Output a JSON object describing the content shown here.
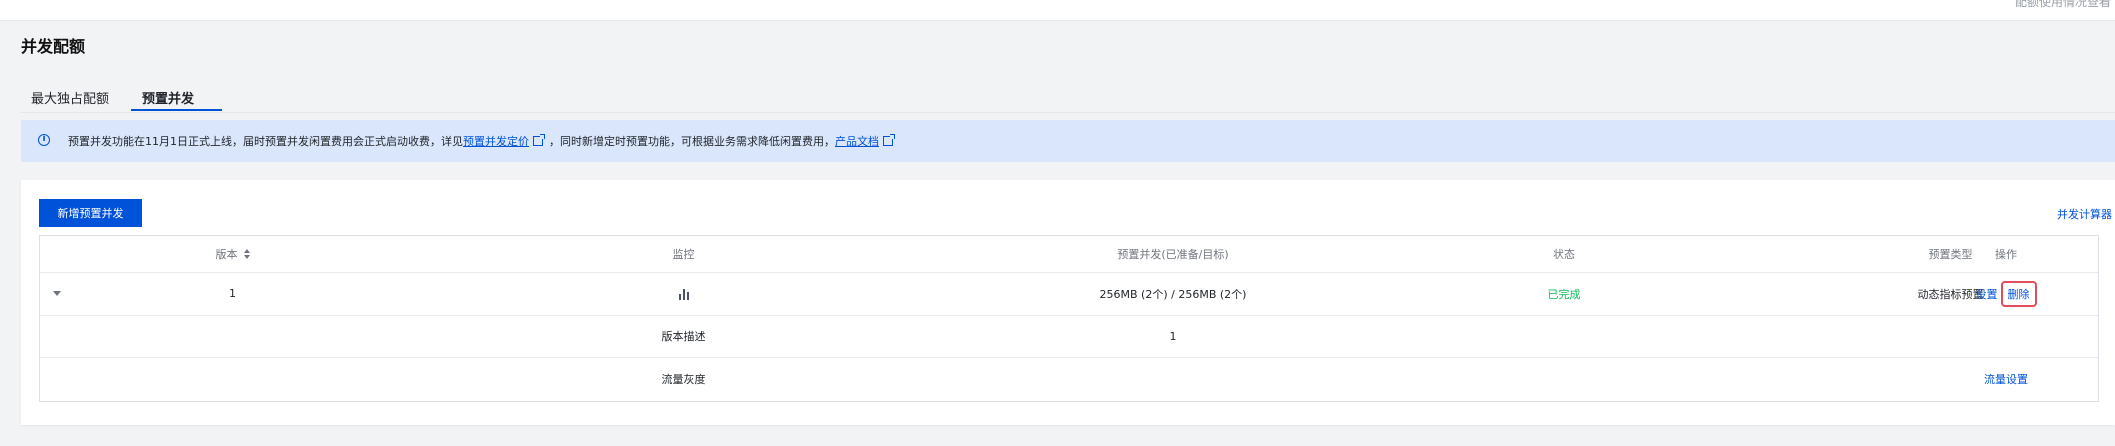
{
  "page": {
    "title": "并发配额",
    "top_right_text": "配额使用情况查看"
  },
  "tabs": [
    {
      "label": "最大独占配额",
      "active": false
    },
    {
      "label": "预置并发",
      "active": true
    }
  ],
  "notice": {
    "icon": "info-icon",
    "text_before": "预置并发功能在11月1日正式上线，届时预置并发闲置费用会正式启动收费，详见",
    "link1": "预置并发定价",
    "text_middle": "，同时新增定时预置功能，可根据业务需求降低闲置费用，",
    "link2": "产品文档"
  },
  "toolbar": {
    "add_button": "新增预置并发",
    "calculator_link": "并发计算器"
  },
  "table": {
    "headers": {
      "version": "版本",
      "monitor": "监控",
      "provisioned": "预置并发(已准备/目标)",
      "status": "状态",
      "type": "预置类型",
      "ops": "操作"
    },
    "row": {
      "version": "1",
      "monitor_icon": "bar-chart-icon",
      "provisioned": "256MB (2个)  / 256MB (2个)",
      "status": "已完成",
      "type": "动态指标预置",
      "op_settings": "设置",
      "op_delete": "删除"
    },
    "detail": {
      "desc_label": "版本描述",
      "desc_value": "1",
      "traffic_label": "流量灰度",
      "traffic_link": "流量设置"
    }
  },
  "colors": {
    "primary": "#0052d9",
    "success": "#0abf5b",
    "highlight_border": "#e34d59",
    "notice_bg": "#d9e6fc"
  }
}
